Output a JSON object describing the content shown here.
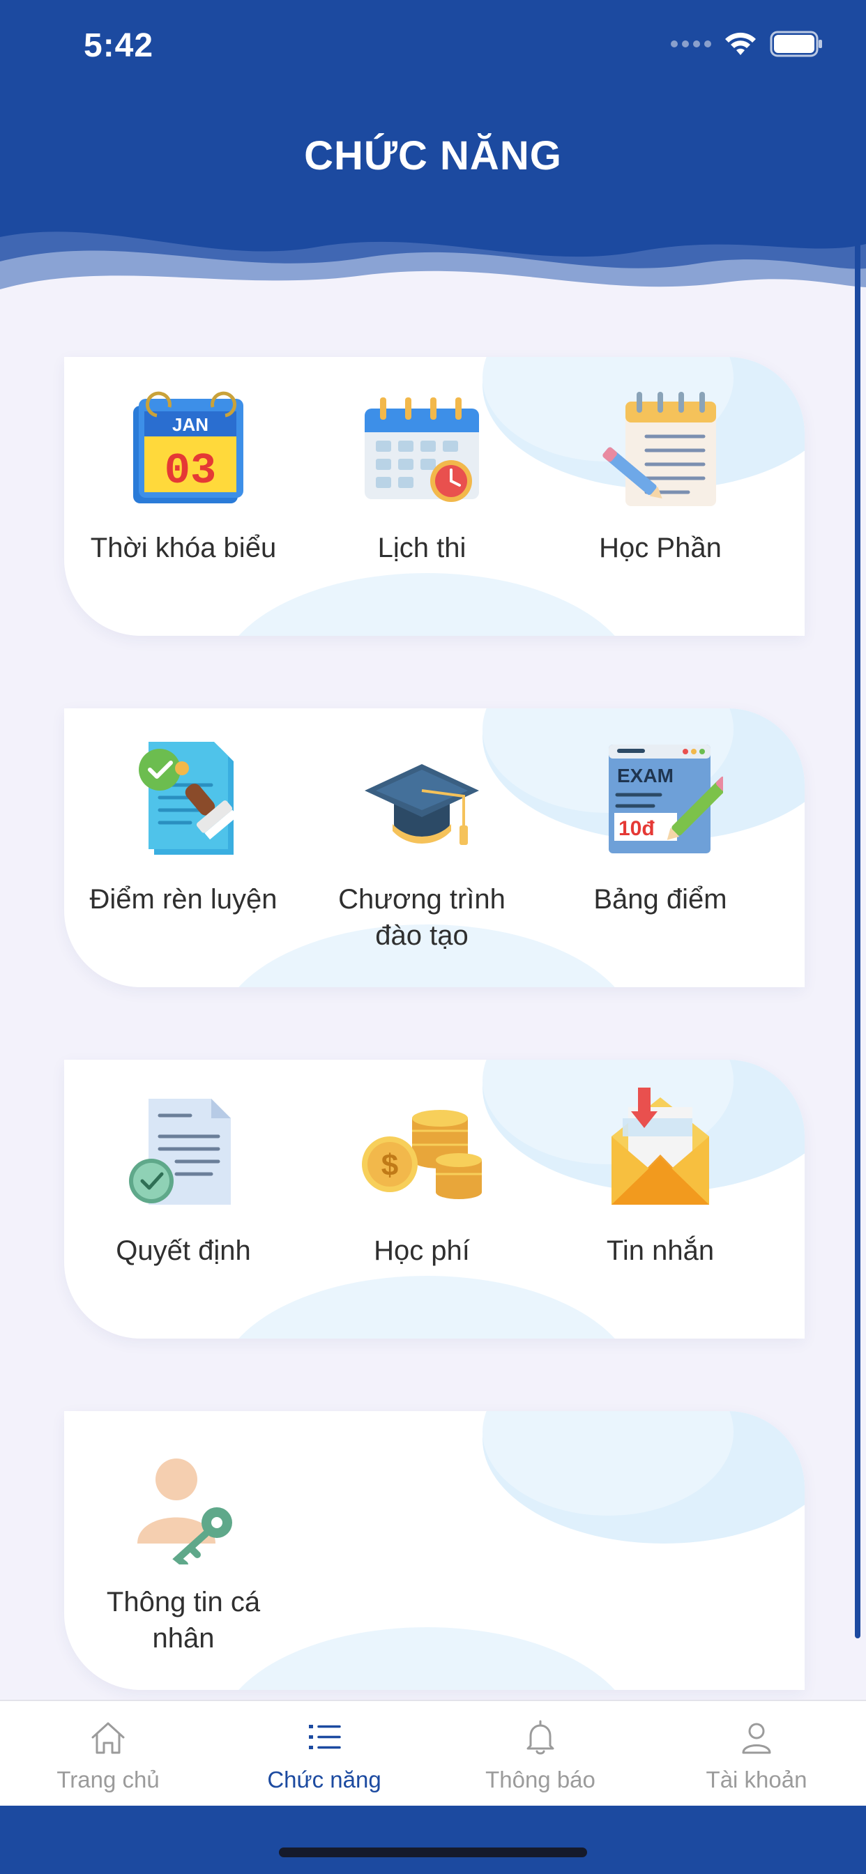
{
  "status": {
    "time": "5:42"
  },
  "header": {
    "title": "CHỨC NĂNG"
  },
  "cards": [
    {
      "items": [
        {
          "label": "Thời khóa biểu",
          "icon": "calendar-date-icon"
        },
        {
          "label": "Lịch thi",
          "icon": "exam-schedule-icon"
        },
        {
          "label": "Học Phần",
          "icon": "notepad-icon"
        }
      ]
    },
    {
      "items": [
        {
          "label": "Điểm rèn luyện",
          "icon": "approved-document-stamp-icon"
        },
        {
          "label": "Chương trình đào tạo",
          "icon": "graduation-cap-icon"
        },
        {
          "label": "Bảng điểm",
          "icon": "exam-grade-icon"
        }
      ]
    },
    {
      "items": [
        {
          "label": "Quyết định",
          "icon": "decision-document-icon"
        },
        {
          "label": "Học phí",
          "icon": "coins-icon"
        },
        {
          "label": "Tin nhắn",
          "icon": "envelope-icon"
        }
      ]
    },
    {
      "items": [
        {
          "label": "Thông tin cá nhân",
          "icon": "user-key-icon"
        }
      ]
    }
  ],
  "tabbar": {
    "tabs": [
      {
        "label": "Trang chủ",
        "icon": "home-icon",
        "active": false
      },
      {
        "label": "Chức năng",
        "icon": "list-icon",
        "active": true
      },
      {
        "label": "Thông báo",
        "icon": "bell-icon",
        "active": false
      },
      {
        "label": "Tài khoản",
        "icon": "user-icon",
        "active": false
      }
    ]
  },
  "colors": {
    "primary": "#1c4aa0",
    "background": "#f3f2fb",
    "inactive": "#9b9b9b"
  }
}
